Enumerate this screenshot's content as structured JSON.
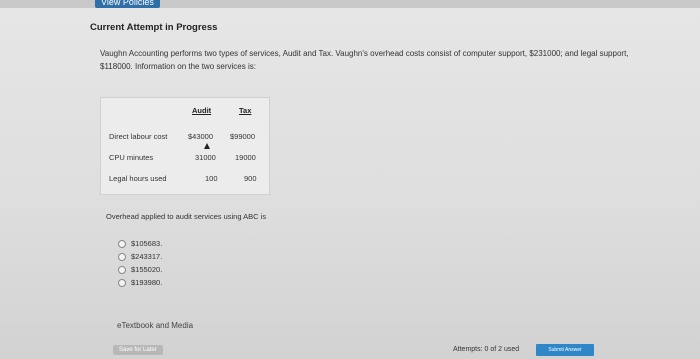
{
  "header": {
    "view_policies": "View Policies"
  },
  "attempt": {
    "title": "Current Attempt in Progress"
  },
  "question": {
    "text": "Vaughn Accounting performs two types of services, Audit and Tax. Vaughn's overhead costs consist of computer support, $231000; and legal support, $118000. Information on the two services is:"
  },
  "table": {
    "headers": [
      "Audit",
      "Tax"
    ],
    "rows": [
      {
        "label": "Direct labour cost",
        "audit": "$43000",
        "tax": "$99000"
      },
      {
        "label": "CPU minutes",
        "audit": "31000",
        "tax": "19000"
      },
      {
        "label": "Legal hours used",
        "audit": "100",
        "tax": "900"
      }
    ]
  },
  "prompt": "Overhead applied to audit services using ABC is",
  "options": [
    "$105683.",
    "$243317.",
    "$155020.",
    "$193980."
  ],
  "footer": {
    "etextbook": "eTextbook and Media",
    "save_later": "Save for Later",
    "attempts": "Attempts: 0 of 2 used",
    "submit": "Submit Answer"
  }
}
